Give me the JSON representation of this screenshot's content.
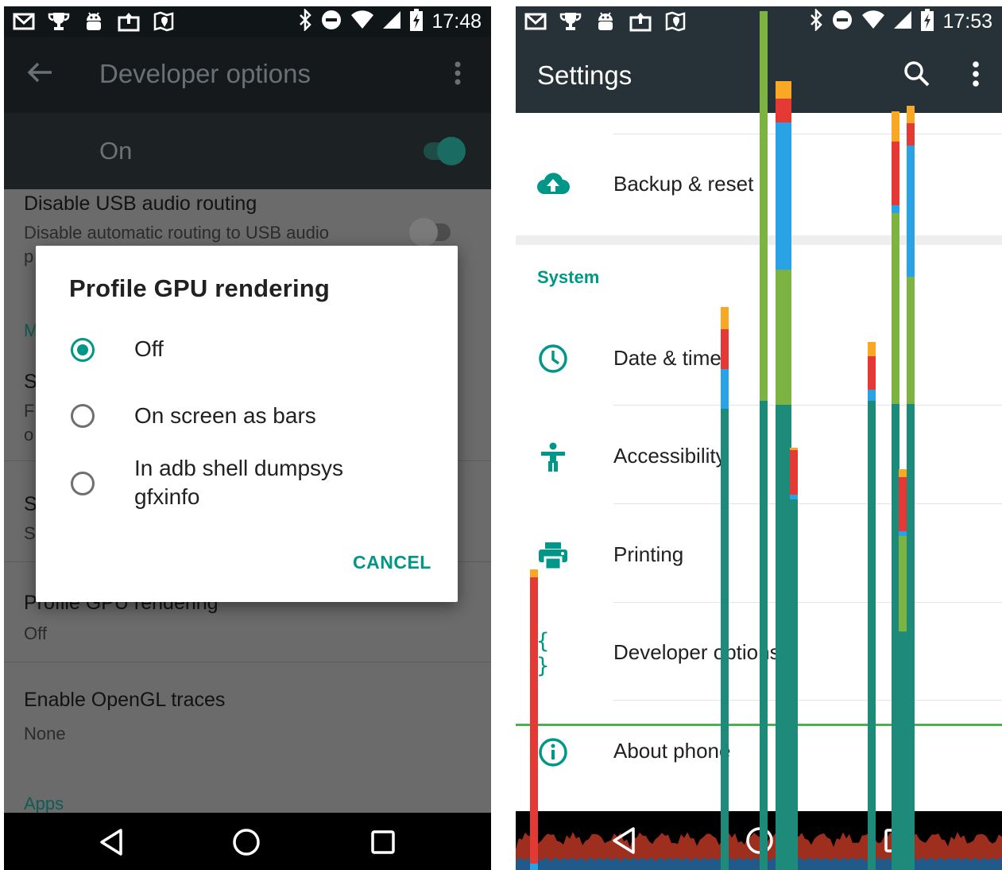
{
  "left_phone": {
    "status": {
      "time": "17:48"
    },
    "appbar": {
      "title": "Developer options"
    },
    "master_switch": {
      "label": "On",
      "state": "on"
    },
    "settings": {
      "usb_audio": {
        "title": "Disable USB audio routing",
        "subtitle": "Disable automatic routing to USB audio",
        "subtitle_line2": "p"
      },
      "partial_category": "M",
      "partial_item1": {
        "title": "S",
        "sub1": "F",
        "sub2": "o"
      },
      "partial_item2": {
        "title": "S",
        "sub": "S"
      },
      "gpu": {
        "title": "Profile GPU rendering",
        "value": "Off"
      },
      "opengl": {
        "title": "Enable OpenGL traces",
        "value": "None"
      },
      "apps_category": "Apps"
    },
    "dialog": {
      "title": "Profile GPU rendering",
      "options": [
        {
          "label": "Off",
          "selected": true
        },
        {
          "label": "On screen as bars",
          "selected": false
        },
        {
          "label": "In adb shell dumpsys\ngfxinfo",
          "selected": false
        }
      ],
      "cancel": "CANCEL"
    }
  },
  "right_phone": {
    "status": {
      "time": "17:53"
    },
    "appbar": {
      "title": "Settings"
    },
    "items": {
      "backup": "Backup & reset",
      "category_system": "System",
      "date_time": "Date & time",
      "accessibility": "Accessibility",
      "printing": "Printing",
      "developer": "Developer options",
      "about": "About phone"
    },
    "icons": {
      "backup": "cloud-upload-icon",
      "date_time": "clock-icon",
      "accessibility": "accessibility-icon",
      "printing": "printer-icon",
      "developer": "braces-icon",
      "about": "info-icon"
    }
  },
  "colors": {
    "accent": "#009688",
    "dark_bar": "#263238",
    "gpu_green": "#7cb342",
    "gpu_teal": "#1e8a7a",
    "gpu_red": "#e53935",
    "gpu_orange": "#f9a825",
    "gpu_blue": "#29a3e6"
  }
}
